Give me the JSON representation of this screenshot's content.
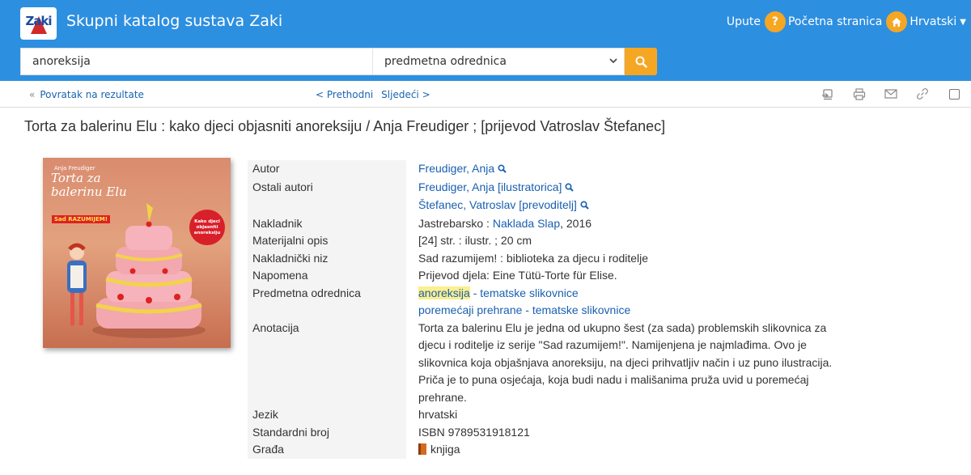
{
  "header": {
    "logo_text": "Zaki",
    "title": "Skupni katalog sustava Zaki",
    "help_label": "Upute",
    "help_icon": "question-icon",
    "home_label": "Početna stranica",
    "home_icon": "home-icon",
    "language_label": "Hrvatski",
    "brand_color": "#2d8fe0",
    "accent_color": "#f5a623"
  },
  "search": {
    "query": "anoreksija",
    "field_selected": "predmetna odrednica",
    "button_icon": "search-icon"
  },
  "nav": {
    "back_label": "Povratak na rezultate",
    "prev_label": "< Prethodni",
    "next_label": "Sljedeći >",
    "tools": [
      "export-icon",
      "print-icon",
      "email-icon",
      "link-icon",
      "select-checkbox"
    ]
  },
  "record": {
    "title": "Torta za balerinu Elu : kako djeci objasniti anoreksiju / Anja Freudiger ; [prijevod Vatroslav Štefanec]",
    "cover": {
      "author": "Anja Freudiger",
      "title_line1": "Torta za",
      "title_line2": "balerinu Elu",
      "series": "Sad RAZUMIJEM!",
      "badge_line1": "Kako djeci",
      "badge_line2": "objasniti",
      "badge_line3": "anoreksiju"
    },
    "fields": {
      "autor_label": "Autor",
      "autor_value": "Freudiger, Anja",
      "ostali_label": "Ostali autori",
      "ostali_1_name": "Freudiger, Anja",
      "ostali_1_role": " [ilustratorica]",
      "ostali_2_name": "Štefanec, Vatroslav",
      "ostali_2_role": " [prevoditelj]",
      "nakladnik_label": "Nakladnik",
      "nakladnik_place": "Jastrebarsko : ",
      "nakladnik_name": "Naklada Slap",
      "nakladnik_year": ", 2016",
      "opis_label": "Materijalni opis",
      "opis_value": "[24] str. : ilustr. ; 20 cm",
      "niz_label": "Nakladnički niz",
      "niz_value": "Sad razumijem! : biblioteka za djecu i roditelje",
      "napomena_label": "Napomena",
      "napomena_value": "Prijevod djela: Eine Tütü-Torte für Elise.",
      "predmet_label": "Predmetna odrednica",
      "predmet_1_hl": "anoreksija",
      "predmet_1_rest": " - tematske slikovnice",
      "predmet_2": "poremećaji prehrane - tematske slikovnice",
      "anotacija_label": "Anotacija",
      "anotacija_lines": [
        "Torta za balerinu Elu je jedna od ukupno šest (za sada) problemskih slikovnica za",
        "djecu i roditelje iz serije \"Sad razumijem!\". Namijenjena je najmlađima. Ovo je",
        "slikovnica koja objašnjava anoreksiju, na djeci prihvatljiv način i uz puno ilustracija.",
        "Priča je to puna osjećaja, koja budi nadu i mališanima pruža uvid u poremećaj",
        "prehrane."
      ],
      "jezik_label": "Jezik",
      "jezik_value": "hrvatski",
      "broj_label": "Standardni broj",
      "broj_value": "ISBN 9789531918121",
      "grada_label": "Građa",
      "grada_value": "knjiga",
      "grada_icon": "book-icon"
    }
  }
}
